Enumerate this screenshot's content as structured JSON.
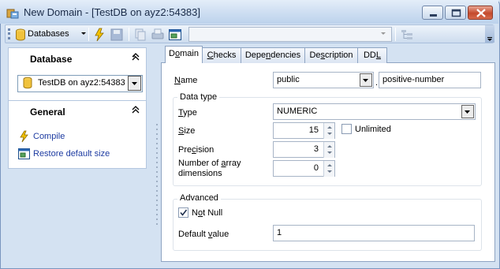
{
  "window": {
    "title": "New Domain - [TestDB on ayz2:54383]"
  },
  "toolbar": {
    "databases_label": "Databases",
    "combo_value": ""
  },
  "nav": {
    "database_header": "Database",
    "database_selected": "TestDB on ayz2:54383",
    "general_header": "General",
    "links": [
      "Compile",
      "Restore default size"
    ]
  },
  "tabs": [
    {
      "label": "Domain",
      "key": "o",
      "active": true
    },
    {
      "label": "Checks",
      "key": "C"
    },
    {
      "label": "Dependencies",
      "key": "n"
    },
    {
      "label": "Description",
      "key": "s"
    },
    {
      "label": "DDL",
      "key": "L"
    }
  ],
  "form": {
    "name_label": "Name",
    "schema_value": "public",
    "name_value": "positive-number",
    "datatype_group": "Data type",
    "type_label": "Type",
    "type_value": "NUMERIC",
    "size_label": "Size",
    "size_value": "15",
    "unlimited_label": "Unlimited",
    "unlimited_checked": false,
    "precision_label": "Precision",
    "precision_value": "3",
    "array_dims_label_1": "Number of array",
    "array_dims_label_2": "dimensions",
    "array_dims_value": "0",
    "advanced_group": "Advanced",
    "not_null_label": "Not Null",
    "not_null_checked": true,
    "default_label": "Default value",
    "default_value": "1"
  },
  "colors": {
    "link": "#1d3ba1",
    "frame": "#d4e2f2",
    "accent": "#7a96bf"
  }
}
